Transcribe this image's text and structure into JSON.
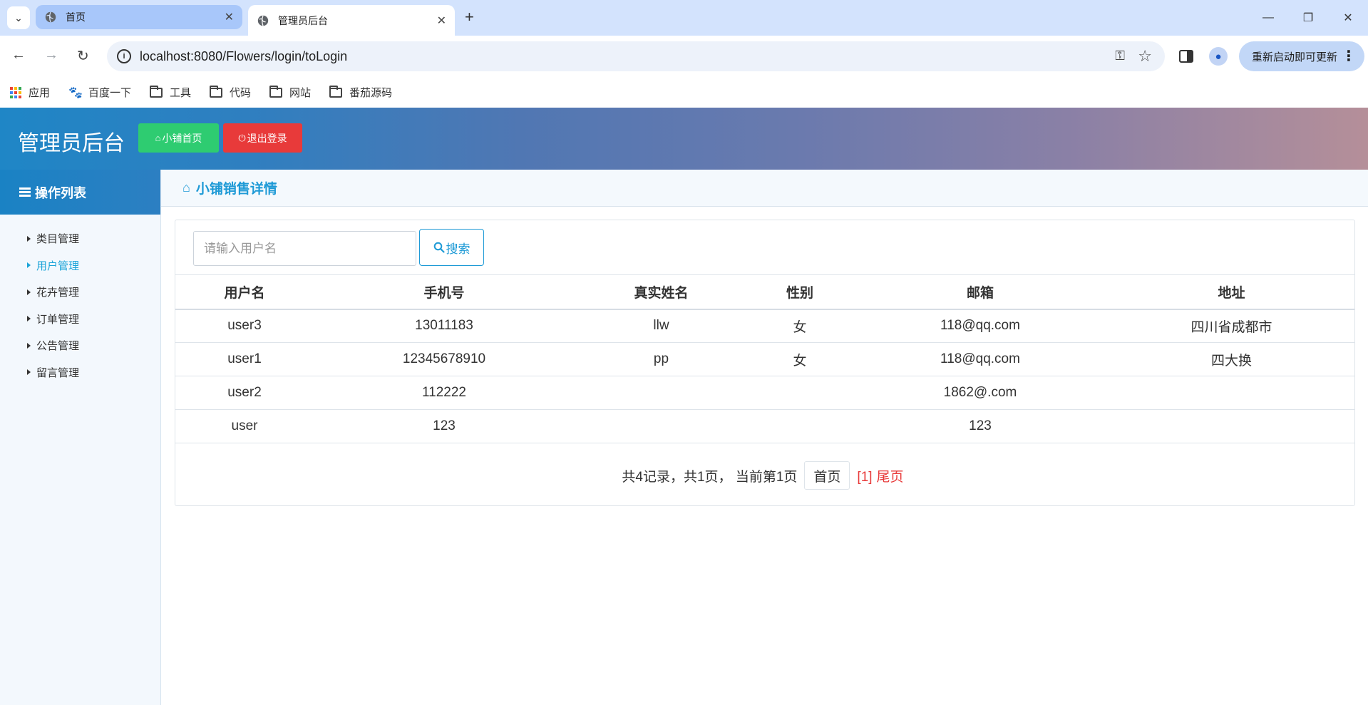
{
  "browser": {
    "tabs": [
      {
        "title": "首页",
        "active": false
      },
      {
        "title": "管理员后台",
        "active": true
      }
    ],
    "url": "localhost:8080/Flowers/login/toLogin",
    "update_label": "重新启动即可更新",
    "bookmarks": [
      {
        "label": "应用",
        "icon": "apps-icon"
      },
      {
        "label": "百度一下",
        "icon": "baidu-paw-icon"
      },
      {
        "label": "工具",
        "icon": "folder-icon"
      },
      {
        "label": "代码",
        "icon": "folder-icon"
      },
      {
        "label": "网站",
        "icon": "folder-icon"
      },
      {
        "label": "番茄源码",
        "icon": "folder-icon"
      }
    ]
  },
  "header": {
    "title": "管理员后台",
    "home_button": "小铺首页",
    "logout_button": "退出登录"
  },
  "sidebar": {
    "title": "操作列表",
    "items": [
      {
        "label": "类目管理",
        "active": false
      },
      {
        "label": "用户管理",
        "active": true
      },
      {
        "label": "花卉管理",
        "active": false
      },
      {
        "label": "订单管理",
        "active": false
      },
      {
        "label": "公告管理",
        "active": false
      },
      {
        "label": "留言管理",
        "active": false
      }
    ]
  },
  "main": {
    "breadcrumb": "小铺销售详情",
    "search": {
      "placeholder": "请输入用户名",
      "button": "搜索"
    },
    "table": {
      "headers": [
        "用户名",
        "手机号",
        "真实姓名",
        "性别",
        "邮箱",
        "地址"
      ],
      "rows": [
        [
          "user3",
          "13011183",
          "llw",
          "女",
          "118@qq.com",
          "四川省成都市"
        ],
        [
          "user1",
          "12345678910",
          "pp",
          "女",
          "118@qq.com",
          "四大换"
        ],
        [
          "user2",
          "112222",
          "",
          "",
          "1862@.com",
          ""
        ],
        [
          "user",
          "123",
          "",
          "",
          "123",
          ""
        ]
      ]
    },
    "pager": {
      "summary": "共4记录，共1页， 当前第1页",
      "first": "首页",
      "current": "[1]",
      "last": "尾页"
    }
  },
  "colors": {
    "accent": "#1e9ad6",
    "green": "#2ecc71",
    "red": "#e83a3a"
  }
}
